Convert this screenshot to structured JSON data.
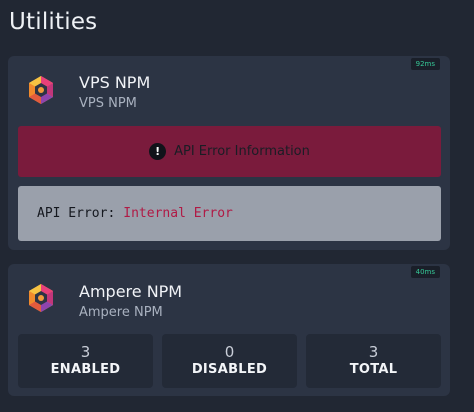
{
  "section": {
    "title": "Utilities"
  },
  "services": [
    {
      "name": "VPS NPM",
      "subtitle": "VPS NPM",
      "latency": "92ms",
      "error": {
        "title": "API Error Information",
        "label": "API Error:",
        "message": "Internal Error"
      }
    },
    {
      "name": "Ampere NPM",
      "subtitle": "Ampere NPM",
      "latency": "40ms",
      "stats": [
        {
          "value": "3",
          "label": "ENABLED"
        },
        {
          "value": "0",
          "label": "DISABLED"
        },
        {
          "value": "3",
          "label": "TOTAL"
        }
      ]
    }
  ],
  "colors": {
    "background": "#212733",
    "card": "#2c3444",
    "error_banner": "#7a1b3c",
    "error_detail": "#9aa0ab",
    "latency_text": "#36c796",
    "error_value": "#b01a45"
  },
  "icons": {
    "service_icon": "nginx-proxy-manager-hexagon-icon",
    "alert_icon": "exclamation-circle-icon"
  }
}
